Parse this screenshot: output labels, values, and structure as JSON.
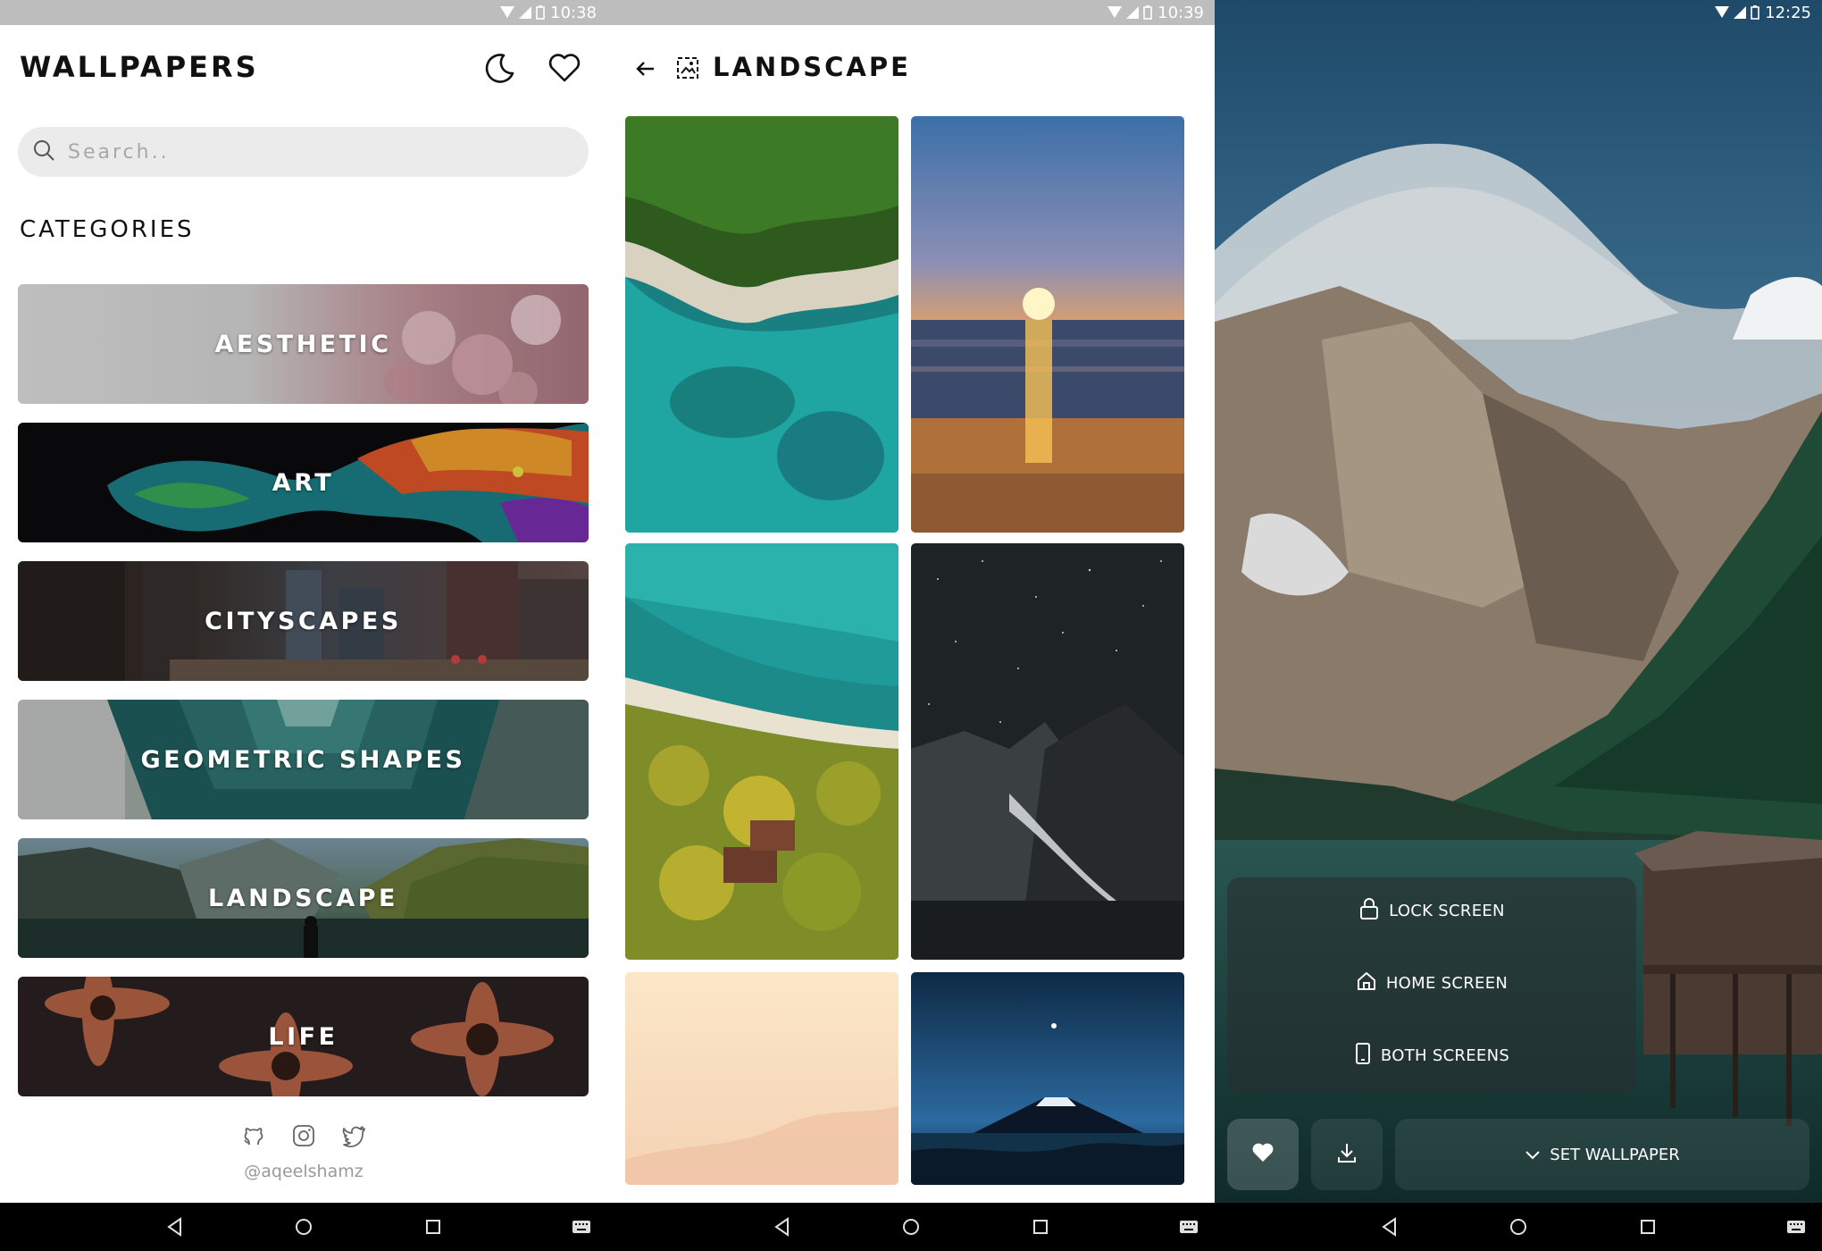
{
  "screen1": {
    "status_time": "10:38",
    "title": "WALLPAPERS",
    "search_placeholder": "Search..",
    "section_title": "CATEGORIES",
    "categories": [
      {
        "label": "AESTHETIC"
      },
      {
        "label": "ART"
      },
      {
        "label": "CITYSCAPES"
      },
      {
        "label": "GEOMETRIC SHAPES"
      },
      {
        "label": "LANDSCAPE"
      },
      {
        "label": "LIFE"
      }
    ],
    "social_handle": "@aqeelshamz",
    "icons": [
      "moon-icon",
      "heart-icon",
      "search-icon",
      "github-icon",
      "instagram-icon",
      "twitter-icon"
    ]
  },
  "screen2": {
    "status_time": "10:39",
    "title": "LANDSCAPE",
    "icons": [
      "back-arrow-icon",
      "image-icon"
    ]
  },
  "screen3": {
    "status_time": "12:25",
    "options": [
      {
        "label": "LOCK SCREEN",
        "icon": "lock-icon"
      },
      {
        "label": "HOME SCREEN",
        "icon": "home-icon"
      },
      {
        "label": "BOTH SCREENS",
        "icon": "phone-icon"
      }
    ],
    "set_wallpaper_label": "SET WALLPAPER",
    "icons": [
      "heart-filled-icon",
      "download-icon",
      "chevron-down-icon"
    ]
  },
  "colors": {
    "status_bar": "#bdbdbd",
    "search_bg": "#ebebeb",
    "nav_bar": "#000000",
    "text_primary": "#111111",
    "text_muted": "#9a9a9a"
  }
}
